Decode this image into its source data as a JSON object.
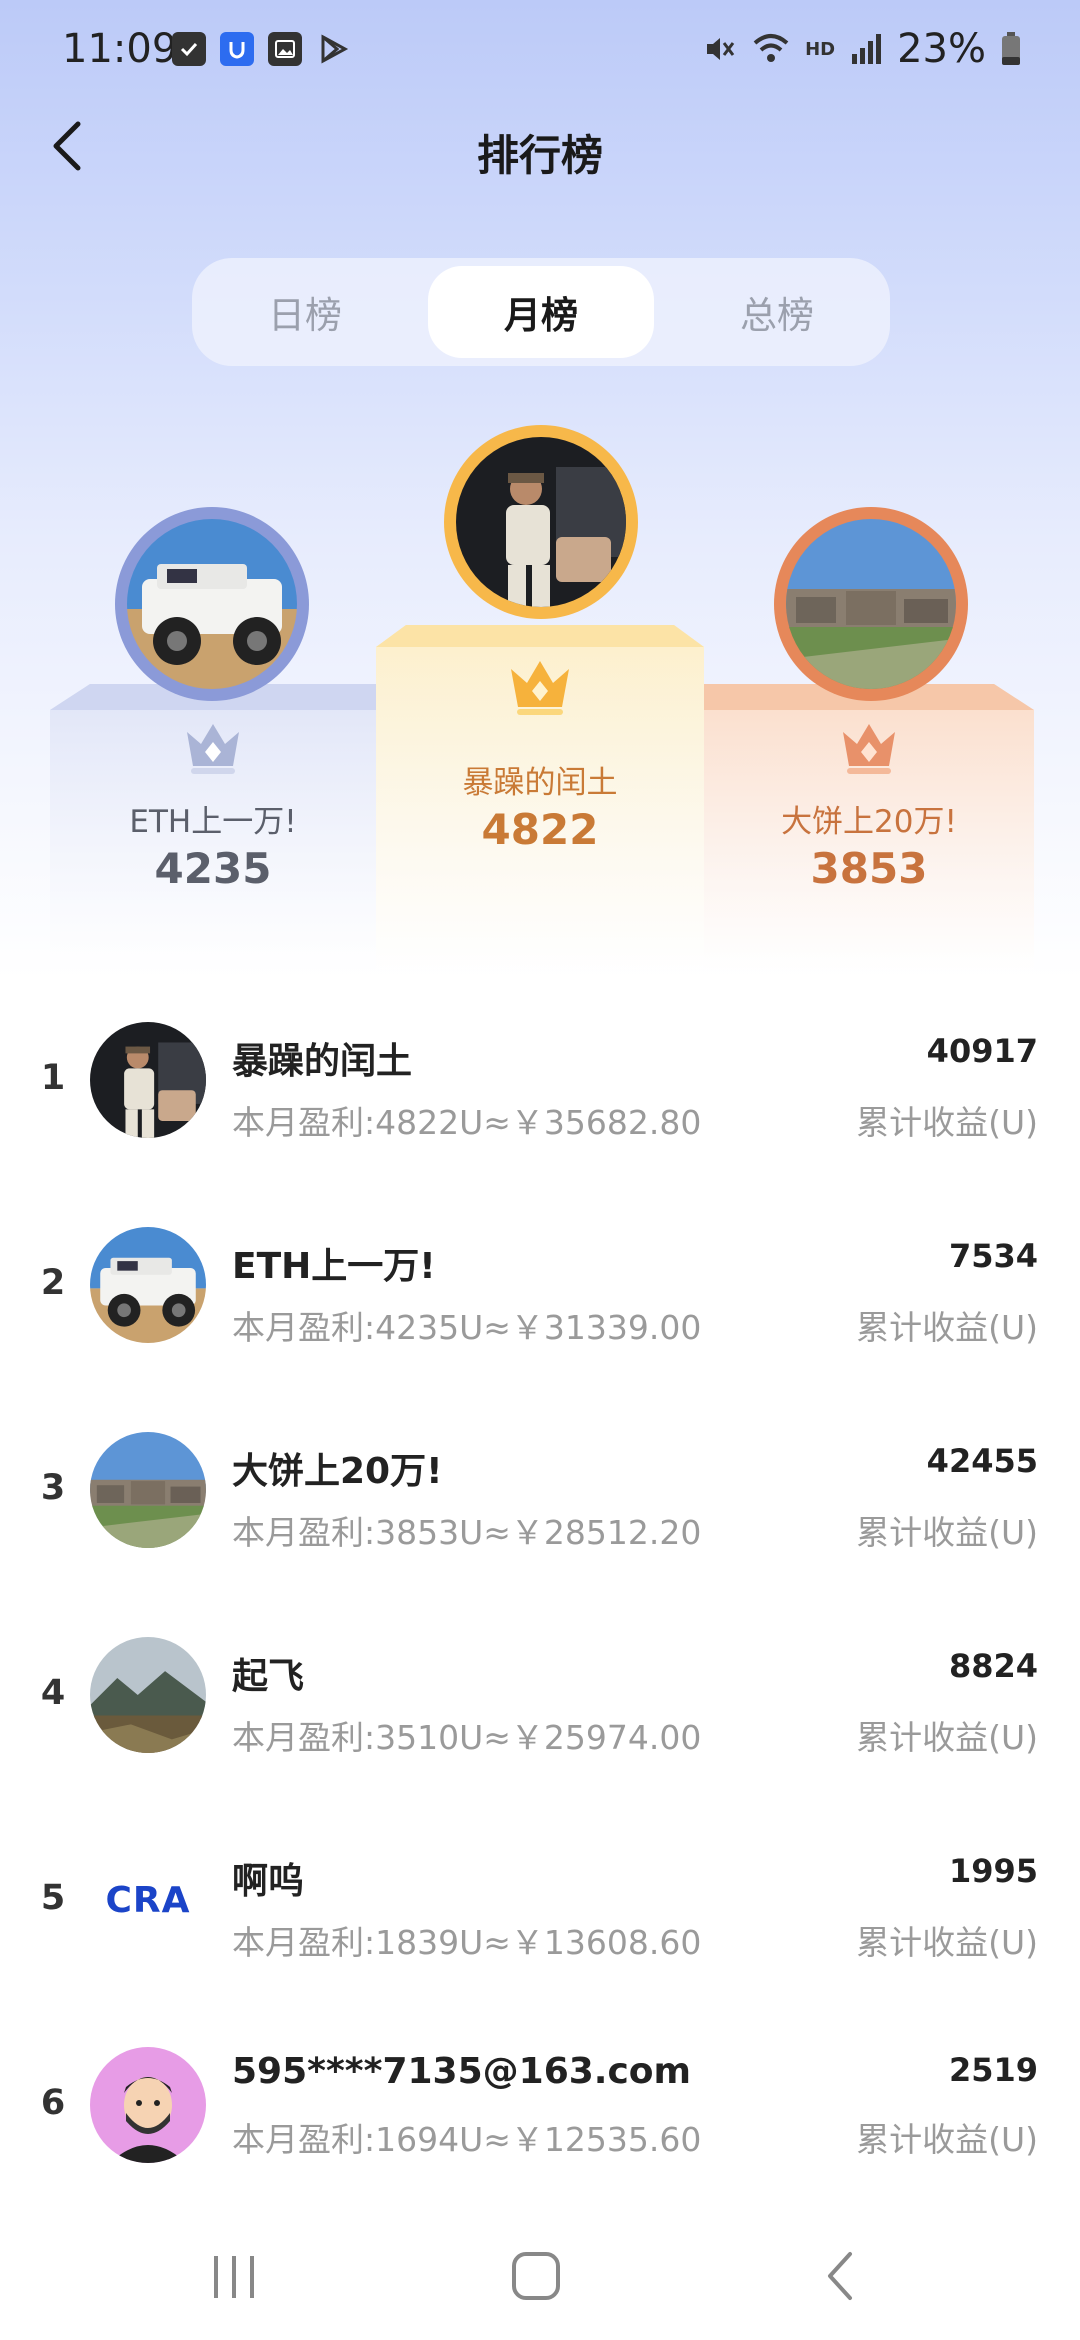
{
  "status_bar": {
    "time": "11:09",
    "battery": "23%",
    "hd": "HD",
    "icons_left": [
      "checkbox-icon",
      "shield-app-icon",
      "gallery-icon",
      "play-store-icon"
    ],
    "icons_right": [
      "mute-icon",
      "wifi-icon",
      "signal-icon",
      "battery-icon"
    ]
  },
  "header": {
    "title": "排行榜",
    "back_icon": "chevron-left-icon"
  },
  "tabs": [
    {
      "label": "日榜",
      "active": false
    },
    {
      "label": "月榜",
      "active": true
    },
    {
      "label": "总榜",
      "active": false
    }
  ],
  "podium": {
    "first": {
      "name": "暴躁的闰土",
      "score": "4822",
      "color": "#c97a36",
      "ring": "#f7b84a"
    },
    "second": {
      "name": "ETH上一万!",
      "score": "4235",
      "color": "#5b5f6b",
      "ring": "#8b9ad8"
    },
    "third": {
      "name": "大饼上20万!",
      "score": "3853",
      "color": "#c8733e",
      "ring": "#e6885a"
    }
  },
  "list": [
    {
      "rank": "1",
      "name": "暴躁的闰土",
      "profit": "本月盈利:4822U≈￥35682.80",
      "score": "40917",
      "label": "累计收益(U)"
    },
    {
      "rank": "2",
      "name": "ETH上一万!",
      "profit": "本月盈利:4235U≈￥31339.00",
      "score": "7534",
      "label": "累计收益(U)"
    },
    {
      "rank": "3",
      "name": "大饼上20万!",
      "profit": "本月盈利:3853U≈￥28512.20",
      "score": "42455",
      "label": "累计收益(U)"
    },
    {
      "rank": "4",
      "name": "起飞",
      "profit": "本月盈利:3510U≈￥25974.00",
      "score": "8824",
      "label": "累计收益(U)"
    },
    {
      "rank": "5",
      "name": "啊呜",
      "profit": "本月盈利:1839U≈￥13608.60",
      "score": "1995",
      "label": "累计收益(U)",
      "logo_text": "CRA"
    },
    {
      "rank": "6",
      "name": "595****7135@163.com",
      "profit": "本月盈利:1694U≈￥12535.60",
      "score": "2519",
      "label": "累计收益(U)"
    }
  ],
  "nav": {
    "recents": "recents-icon",
    "home": "home-icon",
    "back": "back-icon"
  }
}
